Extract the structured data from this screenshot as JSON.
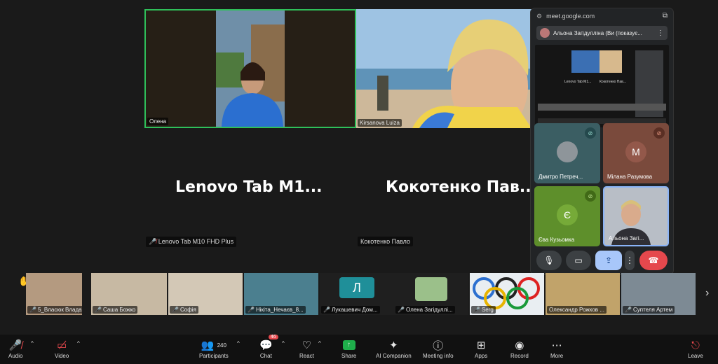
{
  "main": {
    "tiles": [
      {
        "name": "Олена"
      },
      {
        "name": "Kirsanova Luiza"
      }
    ],
    "big_names": [
      "Lenovo  Tab  M1...",
      "Кокотенко  Пав..."
    ],
    "small_names": [
      "Lenovo Tab M10 FHD Plus",
      "Кокотенко Павло"
    ]
  },
  "meet_panel": {
    "url": "meet.google.com",
    "presenter": "Альона Загідулліна (Ви (показує...",
    "preview_labels": [
      "Lenovo Tab M1...",
      "Кокотенко Пав..."
    ],
    "participants": [
      {
        "name": "Дмитро Петреч...",
        "initial": ""
      },
      {
        "name": "Мілана Разумова",
        "initial": "M"
      },
      {
        "name": "Єва Кузьомка",
        "initial": "Є"
      },
      {
        "name": "Альона Загі...",
        "initial": ""
      }
    ]
  },
  "strip": {
    "participants": [
      {
        "name": "5_Власюк Влада"
      },
      {
        "name": "Саша Божко"
      },
      {
        "name": "Софія"
      },
      {
        "name": "Нікіта_Нечаєв_8..."
      },
      {
        "name": "Лукашевич Дом...",
        "initial": "Л"
      },
      {
        "name": "Олена Загідуллі..."
      },
      {
        "name": "Serg"
      },
      {
        "name": "Олександр Рожков ..."
      },
      {
        "name": "Суптеля Артем"
      }
    ]
  },
  "toolbar": {
    "audio": "Audio",
    "video": "Video",
    "participants": "Participants",
    "participants_count": "240",
    "chat": "Chat",
    "chat_badge": "46",
    "react": "React",
    "share": "Share",
    "ai_companion": "AI Companion",
    "meeting_info": "Meeting info",
    "apps": "Apps",
    "record": "Record",
    "more": "More",
    "leave": "Leave"
  },
  "colors": {
    "active_speaker": "#2fbf5a",
    "muted": "#e5484d",
    "share_green": "#1fae4b",
    "end_call": "#e5484d"
  }
}
